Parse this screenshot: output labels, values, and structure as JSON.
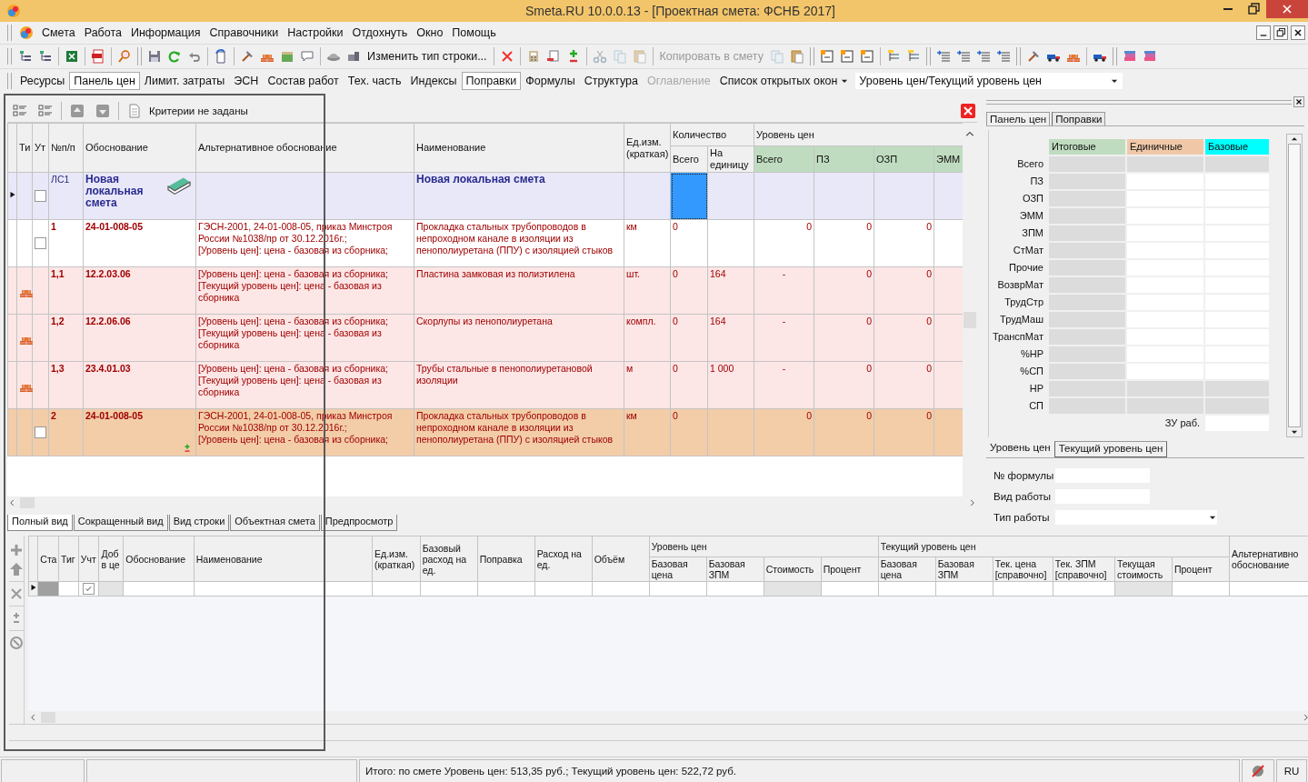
{
  "window": {
    "title": "Smeta.RU  10.0.0.13   - [Проектная смета: ФСНБ 2017]"
  },
  "menu": [
    {
      "label": "Смета"
    },
    {
      "label": "Работа"
    },
    {
      "label": "Информация"
    },
    {
      "label": "Справочники"
    },
    {
      "label": "Настройки"
    },
    {
      "label": "Отдохнуть"
    },
    {
      "label": "Окно"
    },
    {
      "label": "Помощь"
    }
  ],
  "toolbar": {
    "change_row_type": "Изменить тип строки...",
    "copy_to_estimate": {
      "label": "Копировать в смету",
      "disabled": true
    }
  },
  "panel_bar": {
    "items": [
      {
        "label": "Ресурсы",
        "pressed": false,
        "disabled": false
      },
      {
        "label": "Панель цен",
        "pressed": true,
        "disabled": false
      },
      {
        "label": "Лимит. затраты",
        "pressed": false,
        "disabled": false
      },
      {
        "label": "ЭСН",
        "pressed": false,
        "disabled": false
      },
      {
        "label": "Состав работ",
        "pressed": false,
        "disabled": false
      },
      {
        "label": "Тех. часть",
        "pressed": false,
        "disabled": false
      },
      {
        "label": "Индексы",
        "pressed": false,
        "disabled": false
      },
      {
        "label": "Поправки",
        "pressed": true,
        "disabled": false
      },
      {
        "label": "Формулы",
        "pressed": false,
        "disabled": false
      },
      {
        "label": "Структура",
        "pressed": false,
        "disabled": false
      },
      {
        "label": "Оглавление",
        "pressed": false,
        "disabled": true
      }
    ],
    "window_list": "Список открытых окон",
    "level_combo": "Уровень цен/Текущий уровень цен"
  },
  "grid": {
    "filter": "Критерии не заданы",
    "columns": [
      {
        "label": "Ти"
      },
      {
        "label": "Ут"
      },
      {
        "label": "№п/п"
      },
      {
        "label": "Обоснование"
      },
      {
        "label": "Альтернативное обоснование"
      },
      {
        "label": "Наименование"
      },
      {
        "label": "Ед.изм. (краткая)"
      },
      {
        "label": "Количество",
        "children": [
          {
            "label": "Всего"
          },
          {
            "label": "На единицу"
          }
        ]
      },
      {
        "label": "Уровень цен",
        "children": [
          {
            "label": "Всего"
          },
          {
            "label": "ПЗ"
          },
          {
            "label": "ОЗП"
          },
          {
            "label": "ЭММ"
          }
        ]
      }
    ],
    "rows": [
      {
        "kind": "estimate",
        "selected": true,
        "checked": false,
        "number": "ЛС1",
        "code": "Новая локальная смета",
        "name": "Новая локальная смета"
      },
      {
        "kind": "work",
        "selected": false,
        "checked": false,
        "number": "1",
        "code": "24-01-008-05",
        "alt": [
          "ГЭСН-2001, 24-01-008-05, приказ Минстроя",
          "России №1038/пр от 30.12.2016г.;",
          "[Уровень цен]: цена - базовая из сборника;"
        ],
        "name": "Прокладка стальных трубопроводов в непроходном канале в изоляции из пенополиуретана (ППУ) с изоляцией стыков",
        "unit": "км",
        "qty_total": "0",
        "price_total": "0",
        "pz": "0",
        "ozp": "0"
      },
      {
        "kind": "material",
        "selected": false,
        "number": "1,1",
        "code": "12.2.03.06",
        "alt": [
          "[Уровень цен]: цена - базовая из сборника;",
          "[Текущий уровень цен]: цена - базовая из",
          "сборника"
        ],
        "name": "Пластина замковая из полиэтилена",
        "unit": "шт.",
        "qty_total": "0",
        "qty_per_unit": "164",
        "price_total": "-",
        "pz": "0",
        "ozp": "0"
      },
      {
        "kind": "material",
        "selected": false,
        "number": "1,2",
        "code": "12.2.06.06",
        "alt": [
          "[Уровень цен]: цена - базовая из сборника;",
          "[Текущий уровень цен]: цена - базовая из",
          "сборника"
        ],
        "name": "Скорлупы из пенополиуретана",
        "unit": "компл.",
        "qty_total": "0",
        "qty_per_unit": "164",
        "price_total": "-",
        "pz": "0",
        "ozp": "0"
      },
      {
        "kind": "material",
        "selected": false,
        "number": "1,3",
        "code": "23.4.01.03",
        "alt": [
          "[Уровень цен]: цена - базовая из сборника;",
          "[Текущий уровень цен]: цена - базовая из",
          "сборника"
        ],
        "name": "Трубы стальные в пенополиуретановой изоляции",
        "unit": "м",
        "qty_total": "0",
        "qty_per_unit": "1 000",
        "price_total": "-",
        "pz": "0",
        "ozp": "0"
      },
      {
        "kind": "work_changed",
        "selected": false,
        "checked": false,
        "number": "2",
        "code": "24-01-008-05",
        "alt": [
          "ГЭСН-2001, 24-01-008-05, приказ Минстроя",
          "России №1038/пр от 30.12.2016г.;",
          "[Уровень цен]: цена - базовая из сборника;"
        ],
        "name": "Прокладка стальных трубопроводов в непроходном канале в изоляции из пенополиуретана (ППУ) с изоляцией стыков",
        "unit": "км",
        "qty_total": "0",
        "price_total": "0",
        "pz": "0",
        "ozp": "0"
      }
    ],
    "view_tabs": [
      {
        "label": "Полный вид",
        "selected": true
      },
      {
        "label": "Сокращенный вид",
        "selected": false
      },
      {
        "label": "Вид строки",
        "selected": false
      },
      {
        "label": "Объектная смета",
        "selected": false
      },
      {
        "label": "Предпросмотр",
        "selected": false
      }
    ]
  },
  "detail": {
    "columns": [
      {
        "label": "Ста"
      },
      {
        "label": "Тиг"
      },
      {
        "label": "Учт"
      },
      {
        "label": "Доб в це"
      },
      {
        "label": "Обоснование"
      },
      {
        "label": "Наименование"
      },
      {
        "label": "Ед.изм. (краткая)"
      },
      {
        "label": "Базовый расход на ед."
      },
      {
        "label": "Поправка"
      },
      {
        "label": "Расход на ед."
      },
      {
        "label": "Объём"
      },
      {
        "label": "Уровень цен",
        "children": [
          {
            "label": "Базовая цена"
          },
          {
            "label": "Базовая ЗПМ"
          },
          {
            "label": "Стоимость"
          },
          {
            "label": "Процент"
          }
        ]
      },
      {
        "label": "Текущий уровень цен",
        "children": [
          {
            "label": "Базовая цена"
          },
          {
            "label": "Базовая ЗПМ"
          },
          {
            "label": "Тек. цена [справочно]"
          },
          {
            "label": "Тек. ЗПМ [справочно]"
          },
          {
            "label": "Текущая стоимость"
          },
          {
            "label": "Процент"
          }
        ]
      },
      {
        "label": "Альтернативно обоснование"
      }
    ],
    "rows": [
      {
        "selected": true,
        "checked": true
      }
    ]
  },
  "price_panel": {
    "tabs": [
      {
        "label": "Панель цен",
        "selected": true
      },
      {
        "label": "Поправки",
        "selected": false
      }
    ],
    "headers": [
      {
        "label": "Итоговые",
        "color": "#c0dcc0"
      },
      {
        "label": "Единичные",
        "color": "#f0c8a8"
      },
      {
        "label": "Базовые",
        "color": "#00ffff"
      }
    ],
    "rows": [
      {
        "label": "Всего",
        "editable": false
      },
      {
        "label": "ПЗ",
        "editable": true
      },
      {
        "label": "ОЗП",
        "editable": true
      },
      {
        "label": "ЭММ",
        "editable": true
      },
      {
        "label": "ЗПМ",
        "editable": true
      },
      {
        "label": "СтМат",
        "editable": true
      },
      {
        "label": "Прочие",
        "editable": true
      },
      {
        "label": "ВозврМат",
        "editable": true
      },
      {
        "label": "ТрудСтр",
        "editable": true
      },
      {
        "label": "ТрудМаш",
        "editable": true
      },
      {
        "label": "ТранспМат",
        "editable": true
      },
      {
        "label": "%НР",
        "editable": true
      },
      {
        "label": "%СП",
        "editable": true
      },
      {
        "label": "НР",
        "editable": false
      },
      {
        "label": "СП",
        "editable": false
      }
    ],
    "extra_row": {
      "label": "ЗУ раб."
    },
    "bottom_tabs": [
      {
        "label": "Уровень цен",
        "selected": true
      },
      {
        "label": "Текущий уровень цен",
        "selected": false
      }
    ],
    "fields": [
      {
        "label": "№ формулы",
        "kind": "text"
      },
      {
        "label": "Вид работы",
        "kind": "text"
      },
      {
        "label": "Тип работы",
        "kind": "dropdown"
      }
    ]
  },
  "status_bar": {
    "total": "Итого: по смете Уровень цен: 513,35 руб.;  Текущий уровень цен: 522,72 руб.",
    "language": "RU"
  }
}
